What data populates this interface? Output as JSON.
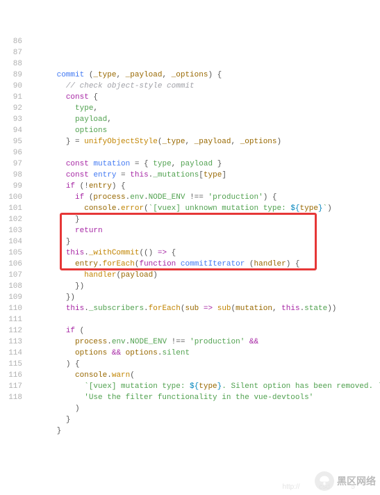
{
  "startLine": 86,
  "highlight": {
    "fromLine": 102,
    "toLine": 106
  },
  "watermark": {
    "text": "黑区网络",
    "iconName": "mushroom-icon",
    "url": "http://          csd           5"
  },
  "code": [
    [
      [
        0,
        "      "
      ],
      [
        "def",
        "commit"
      ],
      [
        "pun",
        " ("
      ],
      [
        "num",
        "_type"
      ],
      [
        "pun",
        ", "
      ],
      [
        "num",
        "_payload"
      ],
      [
        "pun",
        ", "
      ],
      [
        "num",
        "_options"
      ],
      [
        "pun",
        ") {"
      ]
    ],
    [
      [
        0,
        "        "
      ],
      [
        "cmt",
        "// check object-style commit"
      ]
    ],
    [
      [
        0,
        "        "
      ],
      [
        "kw",
        "const"
      ],
      [
        "pun",
        " {"
      ]
    ],
    [
      [
        0,
        "          "
      ],
      [
        "prop",
        "type"
      ],
      [
        "pun",
        ","
      ]
    ],
    [
      [
        0,
        "          "
      ],
      [
        "prop",
        "payload"
      ],
      [
        "pun",
        ","
      ]
    ],
    [
      [
        0,
        "          "
      ],
      [
        "prop",
        "options"
      ]
    ],
    [
      [
        0,
        "        "
      ],
      [
        "pun",
        "} = "
      ],
      [
        "fn",
        "unifyObjectStyle"
      ],
      [
        "pun",
        "("
      ],
      [
        "num",
        "_type"
      ],
      [
        "pun",
        ", "
      ],
      [
        "num",
        "_payload"
      ],
      [
        "pun",
        ", "
      ],
      [
        "num",
        "_options"
      ],
      [
        "pun",
        ")"
      ]
    ],
    [
      [
        0,
        ""
      ]
    ],
    [
      [
        0,
        "        "
      ],
      [
        "kw",
        "const"
      ],
      [
        "pun",
        " "
      ],
      [
        "def",
        "mutation"
      ],
      [
        "pun",
        " = { "
      ],
      [
        "prop",
        "type"
      ],
      [
        "pun",
        ", "
      ],
      [
        "prop",
        "payload"
      ],
      [
        "pun",
        " }"
      ]
    ],
    [
      [
        0,
        "        "
      ],
      [
        "kw",
        "const"
      ],
      [
        "pun",
        " "
      ],
      [
        "def",
        "entry"
      ],
      [
        "pun",
        " = "
      ],
      [
        "kw",
        "this"
      ],
      [
        "pun",
        "."
      ],
      [
        "prop",
        "_mutations"
      ],
      [
        "pun",
        "["
      ],
      [
        "num",
        "type"
      ],
      [
        "pun",
        "]"
      ]
    ],
    [
      [
        0,
        "        "
      ],
      [
        "kw",
        "if"
      ],
      [
        "pun",
        " (!"
      ],
      [
        "num",
        "entry"
      ],
      [
        "pun",
        ") {"
      ]
    ],
    [
      [
        0,
        "          "
      ],
      [
        "kw",
        "if"
      ],
      [
        "pun",
        " ("
      ],
      [
        "num",
        "process"
      ],
      [
        "pun",
        "."
      ],
      [
        "prop",
        "env"
      ],
      [
        "pun",
        "."
      ],
      [
        "prop",
        "NODE_ENV"
      ],
      [
        "pun",
        " !== "
      ],
      [
        "str",
        "'production'"
      ],
      [
        "pun",
        ") {"
      ]
    ],
    [
      [
        0,
        "            "
      ],
      [
        "num",
        "console"
      ],
      [
        "pun",
        "."
      ],
      [
        "fn",
        "error"
      ],
      [
        "pun",
        "("
      ],
      [
        "str",
        "`[vuex] unknown mutation type: "
      ],
      [
        "tpl",
        "${"
      ],
      [
        "num",
        "type"
      ],
      [
        "tpl",
        "}"
      ],
      [
        "str",
        "`"
      ],
      [
        "pun",
        ")"
      ]
    ],
    [
      [
        0,
        "          "
      ],
      [
        "pun",
        "}"
      ]
    ],
    [
      [
        0,
        "          "
      ],
      [
        "kw",
        "return"
      ]
    ],
    [
      [
        0,
        "        "
      ],
      [
        "pun",
        "}"
      ]
    ],
    [
      [
        0,
        "        "
      ],
      [
        "kw",
        "this"
      ],
      [
        "pun",
        "."
      ],
      [
        "fn",
        "_withCommit"
      ],
      [
        "pun",
        "(() "
      ],
      [
        "kw",
        "=>"
      ],
      [
        "pun",
        " {"
      ]
    ],
    [
      [
        0,
        "          "
      ],
      [
        "num",
        "entry"
      ],
      [
        "pun",
        "."
      ],
      [
        "fn",
        "forEach"
      ],
      [
        "pun",
        "("
      ],
      [
        "kw",
        "function"
      ],
      [
        "pun",
        " "
      ],
      [
        "def",
        "commitIterator"
      ],
      [
        "pun",
        " ("
      ],
      [
        "num",
        "handler"
      ],
      [
        "pun",
        ") {"
      ]
    ],
    [
      [
        0,
        "            "
      ],
      [
        "fn",
        "handler"
      ],
      [
        "pun",
        "("
      ],
      [
        "num",
        "payload"
      ],
      [
        "pun",
        ")"
      ]
    ],
    [
      [
        0,
        "          "
      ],
      [
        "pun",
        "})"
      ]
    ],
    [
      [
        0,
        "        "
      ],
      [
        "pun",
        "})"
      ]
    ],
    [
      [
        0,
        "        "
      ],
      [
        "kw",
        "this"
      ],
      [
        "pun",
        "."
      ],
      [
        "prop",
        "_subscribers"
      ],
      [
        "pun",
        "."
      ],
      [
        "fn",
        "forEach"
      ],
      [
        "pun",
        "("
      ],
      [
        "num",
        "sub"
      ],
      [
        "pun",
        " "
      ],
      [
        "kw",
        "=>"
      ],
      [
        "pun",
        " "
      ],
      [
        "fn",
        "sub"
      ],
      [
        "pun",
        "("
      ],
      [
        "num",
        "mutation"
      ],
      [
        "pun",
        ", "
      ],
      [
        "kw",
        "this"
      ],
      [
        "pun",
        "."
      ],
      [
        "prop",
        "state"
      ],
      [
        "pun",
        "))"
      ]
    ],
    [
      [
        0,
        ""
      ]
    ],
    [
      [
        0,
        "        "
      ],
      [
        "kw",
        "if"
      ],
      [
        "pun",
        " ("
      ]
    ],
    [
      [
        0,
        "          "
      ],
      [
        "num",
        "process"
      ],
      [
        "pun",
        "."
      ],
      [
        "prop",
        "env"
      ],
      [
        "pun",
        "."
      ],
      [
        "prop",
        "NODE_ENV"
      ],
      [
        "pun",
        " !== "
      ],
      [
        "str",
        "'production'"
      ],
      [
        "pun",
        " "
      ],
      [
        "kw",
        "&&"
      ]
    ],
    [
      [
        0,
        "          "
      ],
      [
        "num",
        "options"
      ],
      [
        "pun",
        " "
      ],
      [
        "kw",
        "&&"
      ],
      [
        "pun",
        " "
      ],
      [
        "num",
        "options"
      ],
      [
        "pun",
        "."
      ],
      [
        "prop",
        "silent"
      ]
    ],
    [
      [
        0,
        "        "
      ],
      [
        "pun",
        ") {"
      ]
    ],
    [
      [
        0,
        "          "
      ],
      [
        "num",
        "console"
      ],
      [
        "pun",
        "."
      ],
      [
        "fn",
        "warn"
      ],
      [
        "pun",
        "("
      ]
    ],
    [
      [
        0,
        "            "
      ],
      [
        "str",
        "`[vuex] mutation type: "
      ],
      [
        "tpl",
        "${"
      ],
      [
        "num",
        "type"
      ],
      [
        "tpl",
        "}"
      ],
      [
        "str",
        ". Silent option has been removed. `"
      ],
      [
        "pun",
        " +"
      ]
    ],
    [
      [
        0,
        "            "
      ],
      [
        "str",
        "'Use the filter functionality in the vue-devtools'"
      ]
    ],
    [
      [
        0,
        "          "
      ],
      [
        "pun",
        ")"
      ]
    ],
    [
      [
        0,
        "        "
      ],
      [
        "pun",
        "}"
      ]
    ],
    [
      [
        0,
        "      "
      ],
      [
        "pun",
        "}"
      ]
    ]
  ]
}
